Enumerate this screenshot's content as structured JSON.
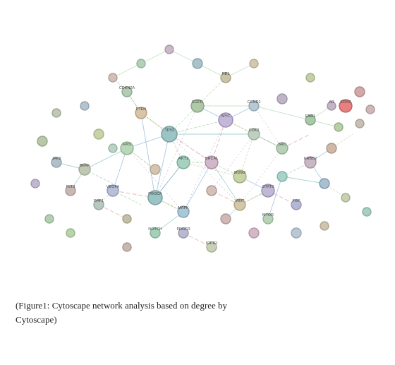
{
  "figure": {
    "caption_line1": "(Figure1:  Cytoscape  network  analysis  based  on  degree  by",
    "caption_line2": "Cytoscape)"
  }
}
